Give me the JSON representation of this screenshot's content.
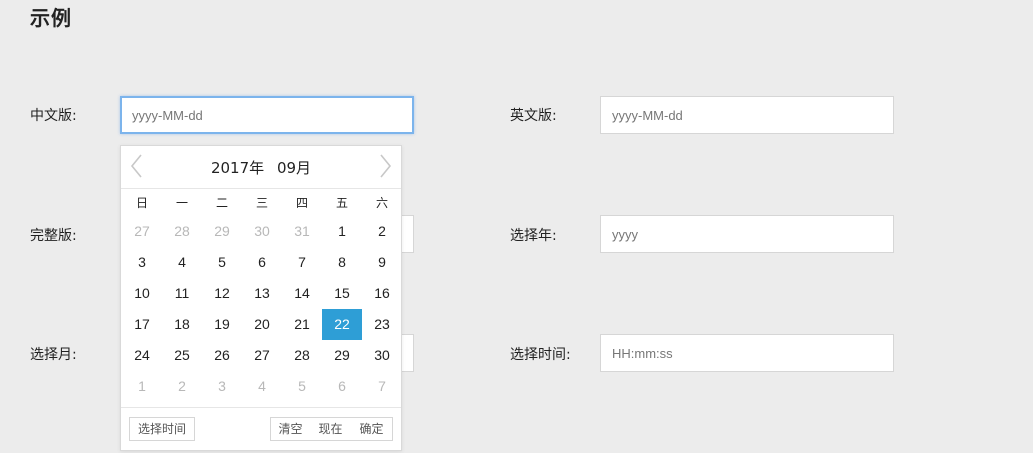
{
  "page": {
    "title": "示例"
  },
  "rows": {
    "chinese": {
      "label": "中文版:",
      "placeholder": "yyyy-MM-dd"
    },
    "english": {
      "label": "英文版:",
      "placeholder": "yyyy-MM-dd"
    },
    "full": {
      "label": "完整版:"
    },
    "year": {
      "label": "选择年:",
      "placeholder": "yyyy"
    },
    "month": {
      "label": "选择月:"
    },
    "time": {
      "label": "选择时间:",
      "placeholder": "HH:mm:ss"
    }
  },
  "picker": {
    "year_label": "2017年",
    "month_label": "09月",
    "prev_icon": "chevron-left-icon",
    "next_icon": "chevron-right-icon",
    "weekdays": [
      "日",
      "一",
      "二",
      "三",
      "四",
      "五",
      "六"
    ],
    "weeks": [
      [
        {
          "d": "27",
          "o": true
        },
        {
          "d": "28",
          "o": true
        },
        {
          "d": "29",
          "o": true
        },
        {
          "d": "30",
          "o": true
        },
        {
          "d": "31",
          "o": true
        },
        {
          "d": "1"
        },
        {
          "d": "2"
        }
      ],
      [
        {
          "d": "3"
        },
        {
          "d": "4"
        },
        {
          "d": "5"
        },
        {
          "d": "6"
        },
        {
          "d": "7"
        },
        {
          "d": "8"
        },
        {
          "d": "9"
        }
      ],
      [
        {
          "d": "10"
        },
        {
          "d": "11"
        },
        {
          "d": "12"
        },
        {
          "d": "13"
        },
        {
          "d": "14"
        },
        {
          "d": "15"
        },
        {
          "d": "16"
        }
      ],
      [
        {
          "d": "17"
        },
        {
          "d": "18"
        },
        {
          "d": "19"
        },
        {
          "d": "20"
        },
        {
          "d": "21"
        },
        {
          "d": "22",
          "s": true
        },
        {
          "d": "23"
        }
      ],
      [
        {
          "d": "24"
        },
        {
          "d": "25"
        },
        {
          "d": "26"
        },
        {
          "d": "27"
        },
        {
          "d": "28"
        },
        {
          "d": "29"
        },
        {
          "d": "30"
        }
      ],
      [
        {
          "d": "1",
          "o": true
        },
        {
          "d": "2",
          "o": true
        },
        {
          "d": "3",
          "o": true
        },
        {
          "d": "4",
          "o": true
        },
        {
          "d": "5",
          "o": true
        },
        {
          "d": "6",
          "o": true
        },
        {
          "d": "7",
          "o": true
        }
      ]
    ],
    "selected_day": "22",
    "footer": {
      "select_time": "选择时间",
      "clear": "清空",
      "now": "现在",
      "confirm": "确定"
    }
  },
  "colors": {
    "accent": "#2e9ed6",
    "focus_border": "#7cb4ec",
    "background": "#ececec"
  }
}
